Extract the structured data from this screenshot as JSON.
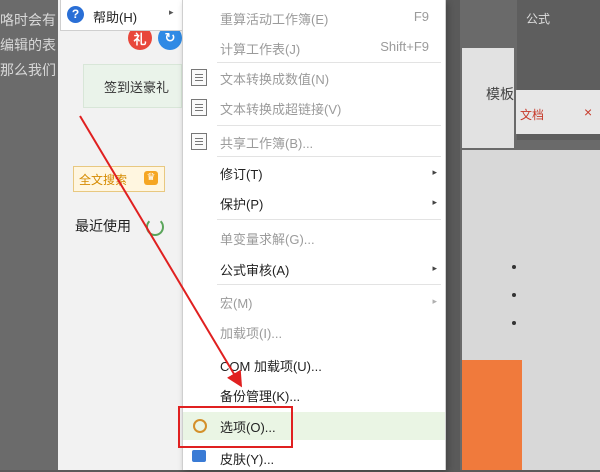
{
  "background": {
    "text_lines": [
      "咯时会有",
      "编辑的表",
      "那么我们"
    ],
    "gift_label": "签到送豪礼",
    "round_icons": [
      {
        "name": "gift-icon",
        "glyph": "礼",
        "color": "#e8473b"
      },
      {
        "name": "refresh-icon",
        "glyph": "↻",
        "color": "#2f8ae5"
      }
    ],
    "fulltext_search": "全文搜索",
    "recent_label": "最近使用",
    "formula_tab": "公式",
    "template_label": "模板",
    "doc_tab": "文档",
    "doc_tab_close": "×"
  },
  "help_menu": {
    "label": "帮助(H)",
    "icon": "question-icon",
    "arrow": "▸"
  },
  "menu_items": [
    {
      "label": "重算活动工作簿(E)",
      "shortcut": "F9",
      "disabled": true
    },
    {
      "label": "计算工作表(J)",
      "shortcut": "Shift+F9",
      "disabled": true
    },
    {
      "label": "文本转换成数值(N)",
      "disabled": true,
      "icon": "doc-number-icon"
    },
    {
      "label": "文本转换成超链接(V)",
      "disabled": true,
      "icon": "doc-link-icon"
    },
    {
      "label": "共享工作簿(B)...",
      "disabled": true,
      "icon": "share-workbook-icon"
    },
    {
      "label": "修订(T)",
      "disabled": false,
      "submenu": "▸"
    },
    {
      "label": "保护(P)",
      "disabled": false,
      "submenu": "▸"
    },
    {
      "label": "单变量求解(G)...",
      "disabled": true
    },
    {
      "label": "公式审核(A)",
      "disabled": false,
      "submenu": "▸"
    },
    {
      "label": "宏(M)",
      "disabled": true,
      "submenu": "▸"
    },
    {
      "label": "加载项(I)...",
      "disabled": true
    },
    {
      "label": "COM 加载项(U)...",
      "disabled": false
    },
    {
      "label": "备份管理(K)...",
      "disabled": false
    },
    {
      "label": "选项(O)...",
      "disabled": false,
      "icon": "gear-icon",
      "highlighted": true
    },
    {
      "label": "皮肤(Y)...",
      "disabled": false,
      "icon": "shirt-icon"
    }
  ],
  "colors": {
    "highlight_box": "#e02020",
    "arrow": "#e02020",
    "selected_row": "#eaf5e4"
  }
}
